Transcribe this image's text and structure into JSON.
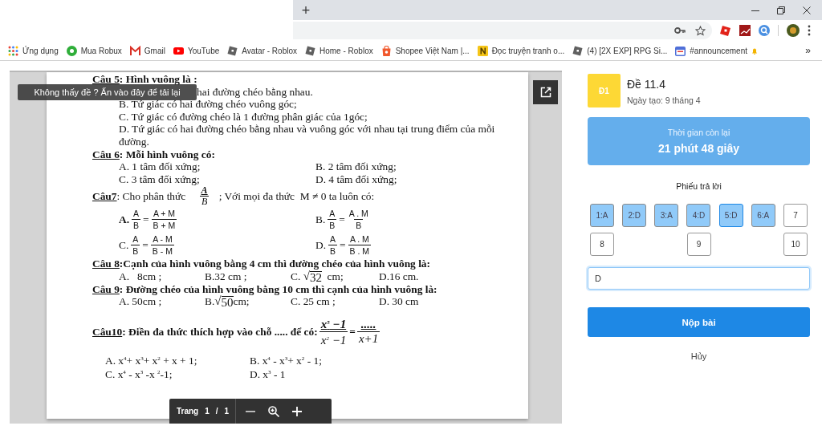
{
  "browser": {
    "new_tab": "+",
    "bookmarks": [
      {
        "label": "Ứng dụng",
        "kind": "apps"
      },
      {
        "label": "Mua Robux",
        "kind": "green"
      },
      {
        "label": "Gmail",
        "kind": "mail"
      },
      {
        "label": "YouTube",
        "kind": "video"
      },
      {
        "label": "Avatar - Roblox",
        "kind": "tile"
      },
      {
        "label": "Home - Roblox",
        "kind": "tile"
      },
      {
        "label": "Shopee Việt Nam |...",
        "kind": "bag"
      },
      {
        "label": "Đọc truyện tranh o...",
        "kind": "book"
      },
      {
        "label": "(4) [2X EXP] RPG Si...",
        "kind": "tile"
      },
      {
        "label": "#announcement",
        "kind": "chat"
      }
    ],
    "bookmarks_more": "»"
  },
  "viewer": {
    "reload_hint": "Không thấy đề ? Ấn vào đây để tải lại",
    "lines": [
      {
        "kind": "heading",
        "number": "Câu 5",
        "bold": true,
        "content": [
          {
            "kind": "text",
            "text": ": Hình vuông là :"
          }
        ]
      },
      {
        "kind": "covered_text",
        "text": "hai đường chéo bằng nhau."
      },
      {
        "kind": "text",
        "text": "B.  Tứ giác có hai đường chéo vuông góc;"
      },
      {
        "kind": "text",
        "text": "C. Tứ giác có đường chéo là 1 đường phân giác của 1góc;"
      },
      {
        "kind": "text",
        "text": "D. Tứ giác có hai đường chéo bằng nhau và vuông góc với nhau tại trung điểm của mỗi đường."
      },
      {
        "kind": "heading",
        "number": "Câu 6",
        "bold": true,
        "content": [
          {
            "kind": "text",
            "text": ": Mỗi hình vuông có:"
          }
        ]
      },
      {
        "kind": "choices_half",
        "choices": [
          {
            "content": [
              {
                "kind": "text",
                "text": "A. 1 tâm đối xứng;"
              }
            ]
          },
          {
            "content": [
              {
                "kind": "text",
                "text": "B. 2 tâm đối xứng;"
              }
            ]
          }
        ]
      },
      {
        "kind": "choices_half",
        "choices": [
          {
            "content": [
              {
                "kind": "text",
                "text": "C. 3 tâm đối xứng;"
              }
            ]
          },
          {
            "content": [
              {
                "kind": "text",
                "text": "D. 4 tâm đối xứng;"
              }
            ]
          }
        ]
      },
      {
        "kind": "heading",
        "number": "Câu7",
        "bold": false,
        "content": [
          {
            "kind": "text",
            "text": ": Cho phân thức "
          },
          {
            "kind": "frac_inline",
            "num": "A",
            "den": "B"
          },
          {
            "kind": "text",
            "text": "; Với mọi đa thức  M ≠ 0 ta luôn có:"
          }
        ]
      },
      {
        "kind": "choices_half",
        "choices": [
          {
            "content": [
              {
                "kind": "text",
                "text": "A.",
                "bold": true
              },
              {
                "kind": "frac",
                "num": "A",
                "den": "B"
              },
              {
                "kind": "text",
                "text": "="
              },
              {
                "kind": "frac",
                "num": "A + M",
                "den": "B + M"
              }
            ]
          },
          {
            "content": [
              {
                "kind": "text",
                "text": "B."
              },
              {
                "kind": "frac",
                "num": "A",
                "den": "B"
              },
              {
                "kind": "text",
                "text": "="
              },
              {
                "kind": "frac",
                "num": "A . M",
                "den": "B"
              }
            ]
          }
        ]
      },
      {
        "kind": "choices_half",
        "choices": [
          {
            "content": [
              {
                "kind": "text",
                "text": "C."
              },
              {
                "kind": "frac",
                "num": "A",
                "den": "B"
              },
              {
                "kind": "text",
                "text": "="
              },
              {
                "kind": "frac",
                "num": "A - M",
                "den": "B - M"
              }
            ]
          },
          {
            "content": [
              {
                "kind": "text",
                "text": "D."
              },
              {
                "kind": "frac",
                "num": "A",
                "den": "B"
              },
              {
                "kind": "text",
                "text": "="
              },
              {
                "kind": "frac",
                "num": "A . M",
                "den": "B . M"
              }
            ]
          }
        ]
      },
      {
        "kind": "heading",
        "number": "Câu 8",
        "bold": true,
        "content": [
          {
            "kind": "text",
            "text": ":Cạnh của hình vuông bằng 4 cm thì đường chéo của hình vuông là:"
          }
        ]
      },
      {
        "kind": "choices_quarter",
        "choices": [
          {
            "content": [
              {
                "kind": "text",
                "text": "A.   8cm ;"
              }
            ]
          },
          {
            "content": [
              {
                "kind": "text",
                "text": "B.32 cm ;"
              }
            ]
          },
          {
            "content": [
              {
                "kind": "text",
                "text": "C. "
              },
              {
                "kind": "sqrt",
                "sign": "√",
                "text": "32"
              },
              {
                "kind": "text",
                "text": "  cm;"
              }
            ]
          },
          {
            "content": [
              {
                "kind": "text",
                "text": "D.16 cm."
              }
            ]
          }
        ]
      },
      {
        "kind": "heading",
        "number": "Câu 9",
        "bold": true,
        "content": [
          {
            "kind": "text",
            "text": ": Đường chéo của hình vuông bằng 10 cm thì cạnh của hình vuông là:"
          }
        ]
      },
      {
        "kind": "choices_quarter",
        "choices": [
          {
            "content": [
              {
                "kind": "text",
                "text": "A. 50cm ;"
              }
            ]
          },
          {
            "content": [
              {
                "kind": "text",
                "text": "B."
              },
              {
                "kind": "sqrt",
                "sign": "√",
                "text": "50"
              },
              {
                "kind": "text",
                "text": "cm;"
              }
            ]
          },
          {
            "content": [
              {
                "kind": "text",
                "text": "C. 25 cm ;"
              }
            ]
          },
          {
            "content": [
              {
                "kind": "text",
                "text": "D. 30 cm"
              }
            ]
          }
        ]
      },
      {
        "kind": "heading",
        "number": "Câu10",
        "bold": true,
        "content": [
          {
            "kind": "text",
            "text": ": Điền đa thức thích hợp vào chỗ ..... để có:"
          },
          {
            "kind": "frac_display",
            "num": "x$^{5}$ −1",
            "den": "x$^{2}$ −1"
          },
          {
            "kind": "text",
            "text": "="
          },
          {
            "kind": "frac_display",
            "num": ".....",
            "den": "x+1"
          }
        ]
      },
      {
        "kind": "choices_narrow",
        "choices": [
          {
            "content": [
              {
                "kind": "text",
                "text": "A. x$^{4}$+ x$^{3}$+ x$^{2}$ + x + 1;"
              }
            ]
          },
          {
            "content": [
              {
                "kind": "text",
                "text": "B. x$^{4}$ - x$^{3}$+ x$^{2}$ - 1;"
              }
            ]
          }
        ]
      },
      {
        "kind": "choices_narrow",
        "choices": [
          {
            "content": [
              {
                "kind": "text",
                "text": "C. x$^{4}$ - x$^{3}$ -x $^{2}$-1;"
              }
            ]
          },
          {
            "content": [
              {
                "kind": "text",
                "text": "D. x$^{3}$ - 1"
              }
            ]
          }
        ]
      }
    ],
    "page_bar": {
      "label": "Trang",
      "current": "1",
      "separator": "/",
      "total": "1"
    }
  },
  "exam": {
    "badge": "Đ1",
    "title": "Đề 11.4",
    "created": "Ngày tạo: 9 tháng 4",
    "timer": {
      "label": "Thời gian còn lại",
      "value": "21 phút 48 giây"
    },
    "sheet_title": "Phiếu trả lời",
    "answers": [
      {
        "label": "1:A",
        "answered": true,
        "selected": false
      },
      {
        "label": "2:D",
        "answered": true,
        "selected": false
      },
      {
        "label": "3:A",
        "answered": true,
        "selected": false
      },
      {
        "label": "4:D",
        "answered": true,
        "selected": false
      },
      {
        "label": "5:D",
        "answered": true,
        "selected": true
      },
      {
        "label": "6:A",
        "answered": true,
        "selected": false
      },
      {
        "label": "7",
        "answered": false,
        "selected": false
      },
      {
        "label": "8",
        "answered": false,
        "selected": false
      },
      {
        "label": "9",
        "answered": false,
        "selected": false
      },
      {
        "label": "10",
        "answered": false,
        "selected": false
      }
    ],
    "answer_field": {
      "value": "D",
      "focused": true
    },
    "submit": "Nộp bài",
    "cancel": "Hủy"
  }
}
